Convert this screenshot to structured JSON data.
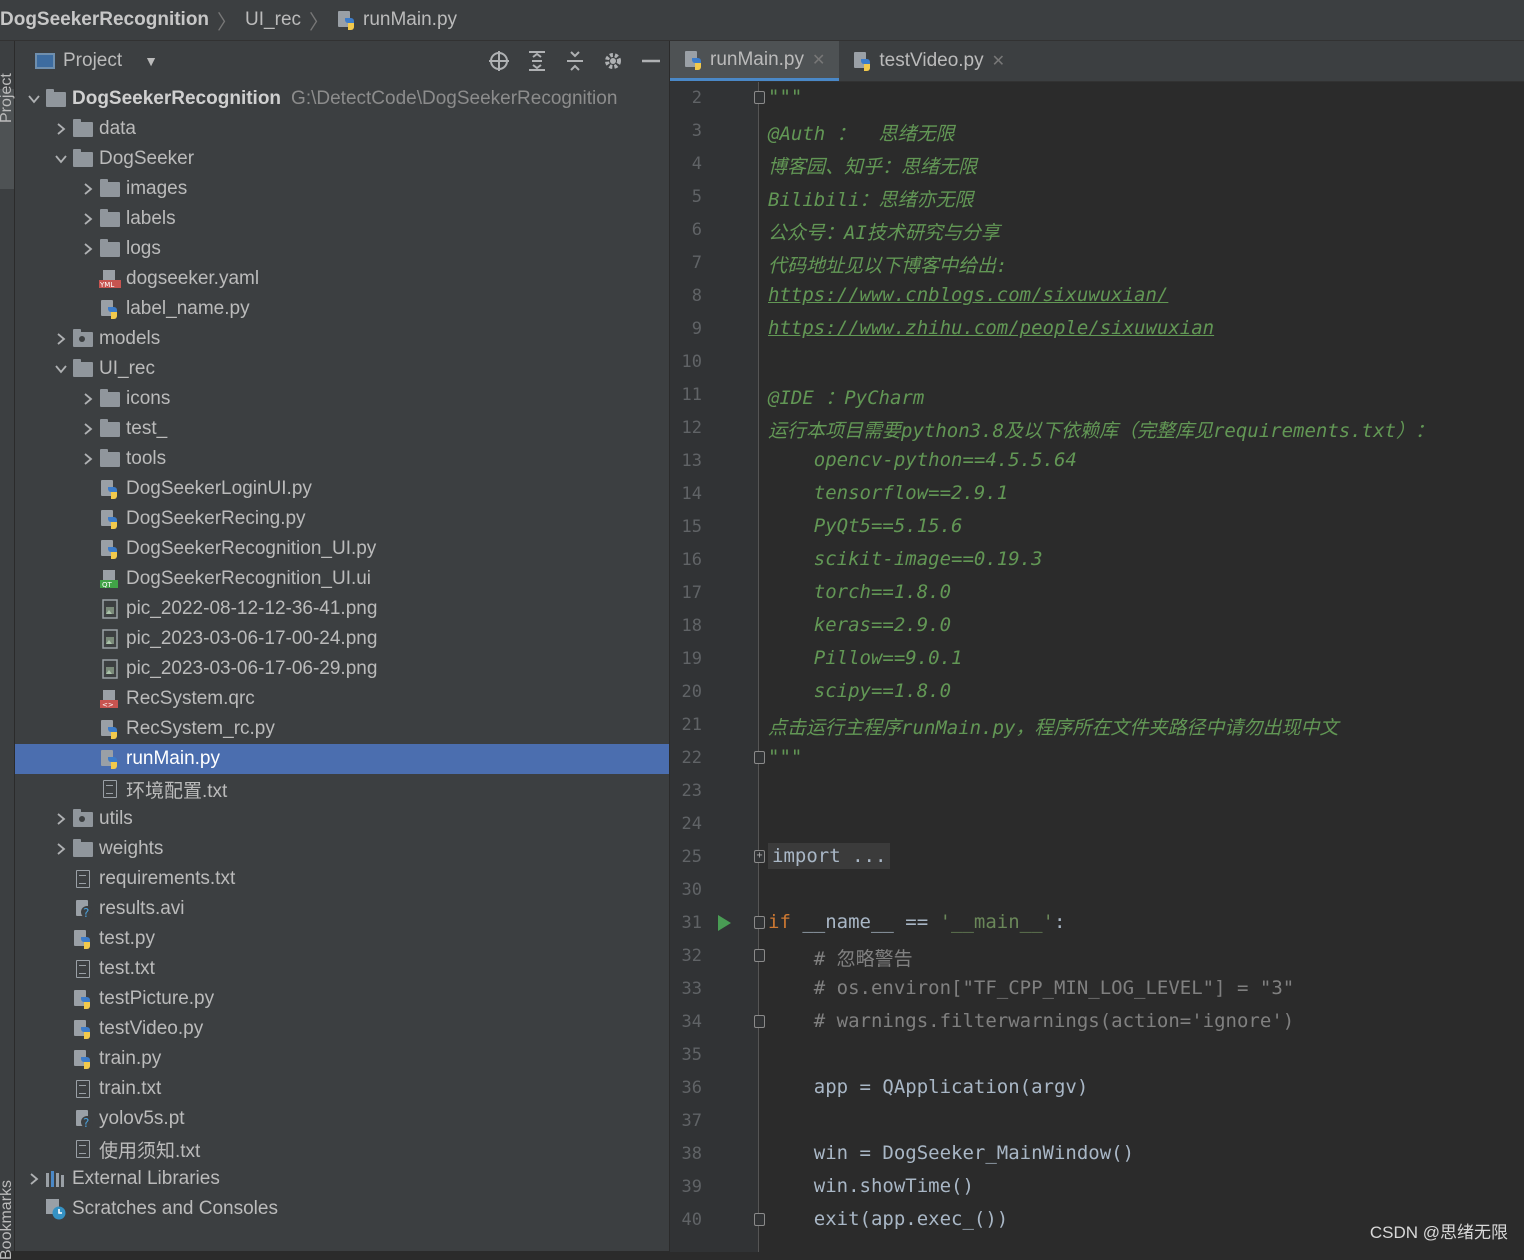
{
  "breadcrumb": {
    "project": "DogSeekerRecognition",
    "folder": "UI_rec",
    "file": "runMain.py"
  },
  "sidestrip": {
    "top": "Project",
    "bottom": "Bookmarks"
  },
  "project_panel": {
    "title": "Project",
    "tools": [
      "locate-icon",
      "expand-all-icon",
      "collapse-all-icon",
      "gear-icon",
      "minimize-icon"
    ],
    "tree": [
      {
        "label": "DogSeekerRecognition",
        "path": "G:\\DetectCode\\DogSeekerRecognition",
        "depth": 0,
        "arrow": "down",
        "icon": "folder",
        "bold": true
      },
      {
        "label": "data",
        "depth": 1,
        "arrow": "right",
        "icon": "folder"
      },
      {
        "label": "DogSeeker",
        "depth": 1,
        "arrow": "down",
        "icon": "folder"
      },
      {
        "label": "images",
        "depth": 2,
        "arrow": "right",
        "icon": "folder"
      },
      {
        "label": "labels",
        "depth": 2,
        "arrow": "right",
        "icon": "folder"
      },
      {
        "label": "logs",
        "depth": 2,
        "arrow": "right",
        "icon": "folder"
      },
      {
        "label": "dogseeker.yaml",
        "depth": 2,
        "arrow": "",
        "icon": "yaml"
      },
      {
        "label": "label_name.py",
        "depth": 2,
        "arrow": "",
        "icon": "py"
      },
      {
        "label": "models",
        "depth": 1,
        "arrow": "right",
        "icon": "folder-dot"
      },
      {
        "label": "UI_rec",
        "depth": 1,
        "arrow": "down",
        "icon": "folder"
      },
      {
        "label": "icons",
        "depth": 2,
        "arrow": "right",
        "icon": "folder"
      },
      {
        "label": "test_",
        "depth": 2,
        "arrow": "right",
        "icon": "folder"
      },
      {
        "label": "tools",
        "depth": 2,
        "arrow": "right",
        "icon": "folder"
      },
      {
        "label": "DogSeekerLoginUI.py",
        "depth": 2,
        "arrow": "",
        "icon": "py"
      },
      {
        "label": "DogSeekerRecing.py",
        "depth": 2,
        "arrow": "",
        "icon": "py"
      },
      {
        "label": "DogSeekerRecognition_UI.py",
        "depth": 2,
        "arrow": "",
        "icon": "py"
      },
      {
        "label": "DogSeekerRecognition_UI.ui",
        "depth": 2,
        "arrow": "",
        "icon": "qt"
      },
      {
        "label": "pic_2022-08-12-12-36-41.png",
        "depth": 2,
        "arrow": "",
        "icon": "img"
      },
      {
        "label": "pic_2023-03-06-17-00-24.png",
        "depth": 2,
        "arrow": "",
        "icon": "img"
      },
      {
        "label": "pic_2023-03-06-17-06-29.png",
        "depth": 2,
        "arrow": "",
        "icon": "img"
      },
      {
        "label": "RecSystem.qrc",
        "depth": 2,
        "arrow": "",
        "icon": "qrc"
      },
      {
        "label": "RecSystem_rc.py",
        "depth": 2,
        "arrow": "",
        "icon": "py"
      },
      {
        "label": "runMain.py",
        "depth": 2,
        "arrow": "",
        "icon": "py",
        "selected": true
      },
      {
        "label": "环境配置.txt",
        "depth": 2,
        "arrow": "",
        "icon": "txt"
      },
      {
        "label": "utils",
        "depth": 1,
        "arrow": "right",
        "icon": "folder-dot"
      },
      {
        "label": "weights",
        "depth": 1,
        "arrow": "right",
        "icon": "folder"
      },
      {
        "label": "requirements.txt",
        "depth": 1,
        "arrow": "",
        "icon": "txt"
      },
      {
        "label": "results.avi",
        "depth": 1,
        "arrow": "",
        "icon": "unknown"
      },
      {
        "label": "test.py",
        "depth": 1,
        "arrow": "",
        "icon": "py"
      },
      {
        "label": "test.txt",
        "depth": 1,
        "arrow": "",
        "icon": "txt"
      },
      {
        "label": "testPicture.py",
        "depth": 1,
        "arrow": "",
        "icon": "py"
      },
      {
        "label": "testVideo.py",
        "depth": 1,
        "arrow": "",
        "icon": "py"
      },
      {
        "label": "train.py",
        "depth": 1,
        "arrow": "",
        "icon": "py"
      },
      {
        "label": "train.txt",
        "depth": 1,
        "arrow": "",
        "icon": "txt"
      },
      {
        "label": "yolov5s.pt",
        "depth": 1,
        "arrow": "",
        "icon": "unknown"
      },
      {
        "label": "使用须知.txt",
        "depth": 1,
        "arrow": "",
        "icon": "txt"
      },
      {
        "label": "External Libraries",
        "depth": 0,
        "arrow": "right",
        "icon": "libs"
      },
      {
        "label": "Scratches and Consoles",
        "depth": 0,
        "arrow": "",
        "icon": "scratch"
      }
    ]
  },
  "editor": {
    "tabs": [
      {
        "label": "runMain.py",
        "active": true
      },
      {
        "label": "testVideo.py",
        "active": false
      }
    ],
    "lines": [
      {
        "n": "2",
        "cls": "cm",
        "text": "\"\"\"",
        "fold": "top"
      },
      {
        "n": "3",
        "cls": "cm",
        "text": "@Auth ：  思绪无限"
      },
      {
        "n": "4",
        "cls": "cm",
        "text": "博客园、知乎：思绪无限"
      },
      {
        "n": "5",
        "cls": "cm",
        "text": "Bilibili：思绪亦无限"
      },
      {
        "n": "6",
        "cls": "cm",
        "text": "公众号：AI技术研究与分享"
      },
      {
        "n": "7",
        "cls": "cm",
        "text": "代码地址见以下博客中给出:"
      },
      {
        "n": "8",
        "cls": "cmu",
        "text": "https://www.cnblogs.com/sixuwuxian/"
      },
      {
        "n": "9",
        "cls": "cmu",
        "text": "https://www.zhihu.com/people/sixuwuxian"
      },
      {
        "n": "10",
        "cls": "cm",
        "text": ""
      },
      {
        "n": "11",
        "cls": "cm",
        "text": "@IDE ：PyCharm"
      },
      {
        "n": "12",
        "cls": "cm",
        "text": "运行本项目需要python3.8及以下依赖库（完整库见requirements.txt）："
      },
      {
        "n": "13",
        "cls": "cm",
        "text": "    opencv-python==4.5.5.64"
      },
      {
        "n": "14",
        "cls": "cm",
        "text": "    tensorflow==2.9.1"
      },
      {
        "n": "15",
        "cls": "cm",
        "text": "    PyQt5==5.15.6"
      },
      {
        "n": "16",
        "cls": "cm",
        "text": "    scikit-image==0.19.3"
      },
      {
        "n": "17",
        "cls": "cm",
        "text": "    torch==1.8.0"
      },
      {
        "n": "18",
        "cls": "cm",
        "text": "    keras==2.9.0"
      },
      {
        "n": "19",
        "cls": "cm",
        "text": "    Pillow==9.0.1"
      },
      {
        "n": "20",
        "cls": "cm",
        "text": "    scipy==1.8.0"
      },
      {
        "n": "21",
        "cls": "cm",
        "text": "点击运行主程序runMain.py，程序所在文件夹路径中请勿出现中文"
      },
      {
        "n": "22",
        "cls": "cm",
        "text": "\"\"\"",
        "fold": "bottom"
      },
      {
        "n": "23",
        "cls": "",
        "text": ""
      },
      {
        "n": "24",
        "cls": "",
        "text": ""
      },
      {
        "n": "25",
        "cls": "import",
        "text": "import ...",
        "fold": "plus"
      },
      {
        "n": "30",
        "cls": "",
        "text": ""
      },
      {
        "n": "31",
        "cls": "main",
        "text": "",
        "fold": "top",
        "run": true
      },
      {
        "n": "32",
        "cls": "gc",
        "text": "    # 忽略警告",
        "fold": "top"
      },
      {
        "n": "33",
        "cls": "gcstr",
        "text": "    # os.environ[\"TF_CPP_MIN_LOG_LEVEL\"] = \"3\""
      },
      {
        "n": "34",
        "cls": "gc",
        "text": "    # warnings.filterwarnings(action='ignore')",
        "fold": "bottom"
      },
      {
        "n": "35",
        "cls": "",
        "text": ""
      },
      {
        "n": "36",
        "cls": "plain",
        "text": "    app = QApplication(argv)"
      },
      {
        "n": "37",
        "cls": "",
        "text": ""
      },
      {
        "n": "38",
        "cls": "plain",
        "text": "    win = DogSeeker_MainWindow()"
      },
      {
        "n": "39",
        "cls": "plain",
        "text": "    win.showTime()"
      },
      {
        "n": "40",
        "cls": "plain",
        "text": "    exit(app.exec_())",
        "fold": "bottom"
      }
    ],
    "main_line": {
      "kw": "if",
      "name": " __name__ == ",
      "str": "'__main__'",
      "colon": ":"
    }
  },
  "watermark": "CSDN @思绪无限",
  "colors": {
    "panel_bg": "#3c3f41",
    "editor_bg": "#2b2b2b",
    "selection": "#4b6eaf",
    "comment": "#629755",
    "keyword": "#cc7832",
    "string": "#6a8759"
  }
}
